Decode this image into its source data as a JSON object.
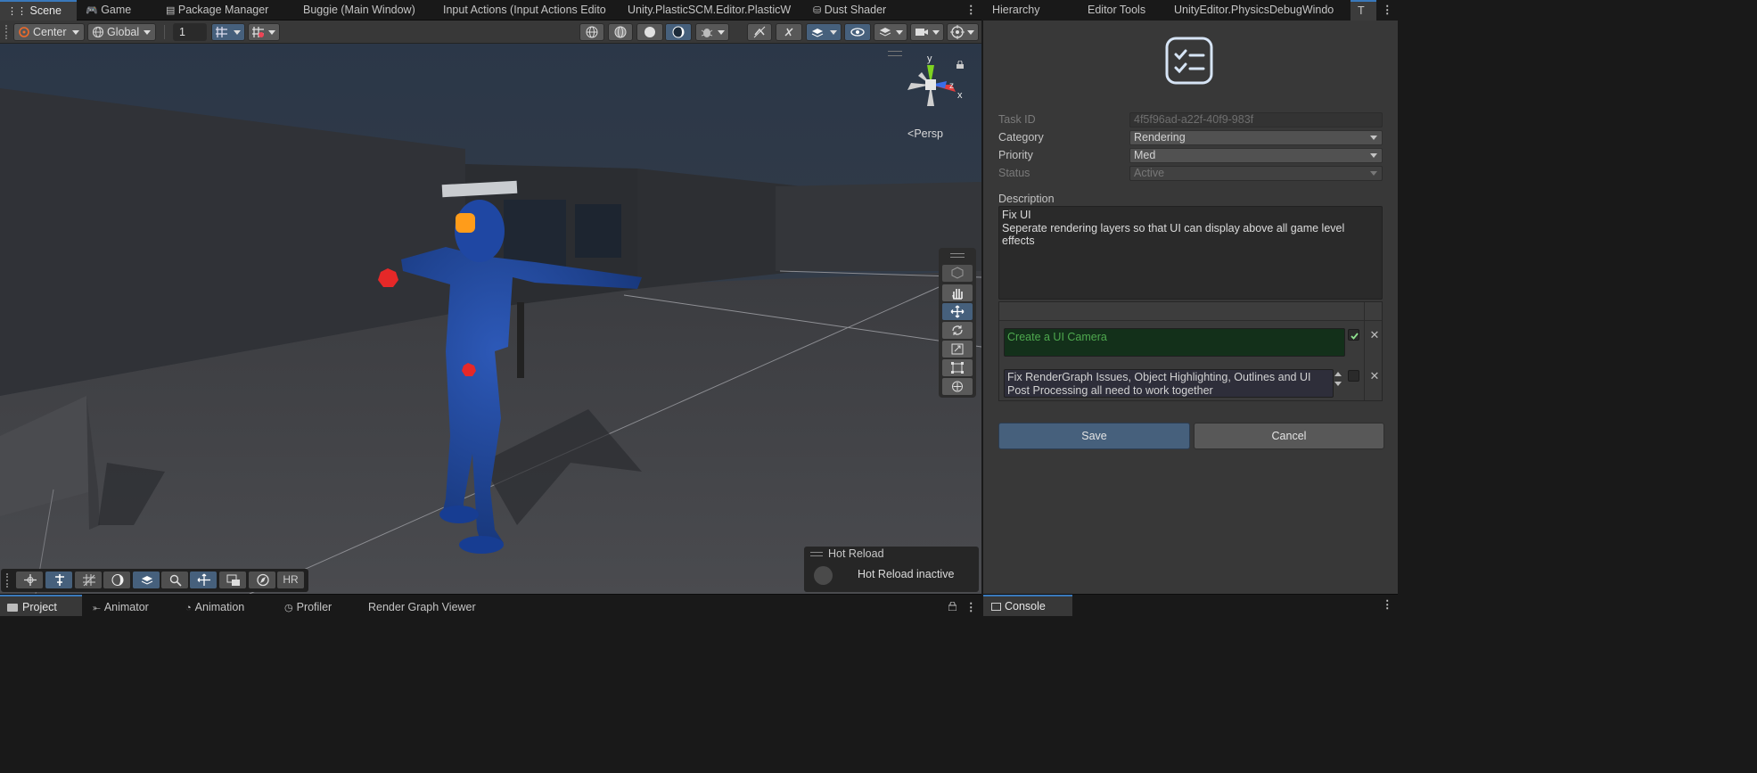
{
  "left_tabs": [
    {
      "label": "Scene",
      "icon": "grid-icon",
      "active": true
    },
    {
      "label": "Game",
      "icon": "gamepad-icon"
    },
    {
      "label": "Package Manager",
      "icon": "package-icon"
    },
    {
      "label": "Buggie (Main Window)"
    },
    {
      "label": "Input Actions (Input Actions Edito"
    },
    {
      "label": "Unity.PlasticSCM.Editor.PlasticW"
    },
    {
      "label": "Dust Shader",
      "icon": "shader-icon"
    }
  ],
  "right_tabs": [
    {
      "label": "Hierarchy"
    },
    {
      "label": "Editor Tools"
    },
    {
      "label": "UnityEditor.PhysicsDebugWindo"
    },
    {
      "label": "T"
    }
  ],
  "toolbar": {
    "pivot_label": "Center",
    "space_label": "Global",
    "grid_value": "1"
  },
  "scene": {
    "orientation_label": "Persp",
    "gizmo_axes": {
      "y": "y",
      "x": "x",
      "z": "z"
    }
  },
  "hot_reload": {
    "title": "Hot Reload",
    "status": "Hot Reload inactive"
  },
  "bottom_toolbar": {
    "hr_label": "HR"
  },
  "task": {
    "task_id_label": "Task ID",
    "task_id": "4f5f96ad-a22f-40f9-983f",
    "category_label": "Category",
    "category": "Rendering",
    "priority_label": "Priority",
    "priority": "Med",
    "status_label": "Status",
    "status": "Active",
    "description_label": "Description",
    "description_lines": [
      "Fix UI",
      "Seperate rendering layers so that UI can display above all game level",
      "effects"
    ],
    "subtasks": [
      {
        "text": "Create a UI Camera",
        "done": true
      },
      {
        "text_line1": "Fix RenderGraph Issues, Object Highlighting, Outlines and UI",
        "text_line2": "Post Processing all need to work together",
        "done": false
      }
    ],
    "save_label": "Save",
    "cancel_label": "Cancel"
  },
  "bottom_tabs": [
    {
      "label": "Project",
      "icon": "folder-icon",
      "active": true
    },
    {
      "label": "Animator",
      "icon": "animator-icon"
    },
    {
      "label": "Animation",
      "icon": "animation-icon"
    },
    {
      "label": "Profiler",
      "icon": "profiler-icon"
    },
    {
      "label": "Render Graph Viewer"
    }
  ],
  "console_tab": {
    "label": "Console"
  },
  "colors": {
    "accent": "#3a79bb",
    "selected": "#46607c",
    "panel": "#383838",
    "done_green": "#4ea84e",
    "subtask_done_bg": "#13301a"
  }
}
